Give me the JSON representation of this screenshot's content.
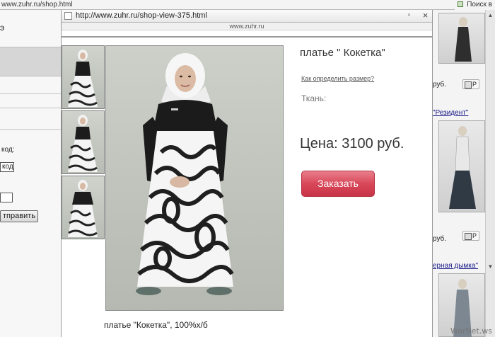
{
  "background": {
    "url": "www.zuhr.ru/shop.html",
    "search_label": "Поиск в",
    "left_labels": {
      "code_label": "код:",
      "code_input": "код",
      "submit_label": "тправить"
    },
    "right": {
      "items": [
        {
          "price": "руб.",
          "order_label": "Р"
        },
        {
          "title": "\"Резидент\"",
          "price": "руб.",
          "order_label": "Р"
        },
        {
          "title": "ерная дымка\"",
          "price": ""
        }
      ]
    }
  },
  "popup": {
    "title": "http://www.zuhr.ru/shop-view-375.html",
    "site_label": "www.zuhr.ru",
    "close_glyph": "×",
    "product": {
      "title": "платье \" Кокетка\"",
      "size_link": "Как определить размер?",
      "fabric_label": "Ткань:",
      "price": "Цена: 3100 руб.",
      "order_button": "Заказать",
      "caption": "платье \"Кокетка\", 100%х/б"
    }
  },
  "watermark": "WarNet.ws",
  "colors": {
    "order_button": "#d8485a",
    "photo_bg": "#c2c6bf",
    "link": "#1a1a8a"
  }
}
